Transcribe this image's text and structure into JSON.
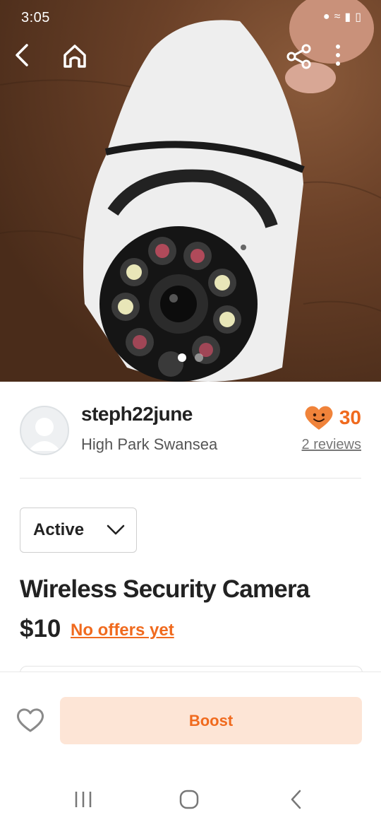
{
  "status_bar": {
    "time": "3:05"
  },
  "listing": {
    "image_alt": "white bulb-style wireless security camera",
    "photo_index_active": 0,
    "photo_count": 2
  },
  "seller": {
    "name": "steph22june",
    "location": "High Park Swansea",
    "rating_count": "30",
    "reviews_label": "2 reviews"
  },
  "status_dropdown": {
    "value": "Active"
  },
  "item": {
    "title": "Wireless Security Camera",
    "price": "$10",
    "offers_label": "No offers yet"
  },
  "actions": {
    "boost_label": "Boost"
  },
  "colors": {
    "accent": "#f06a1e",
    "boost_bg": "#fde5d6",
    "heart": "#f0833a"
  },
  "icons": [
    "back-arrow-icon",
    "home-icon",
    "share-icon",
    "more-vertical-icon",
    "smiley-heart-icon",
    "chevron-down-icon",
    "favorite-heart-icon",
    "recents-icon",
    "home-circle-icon",
    "nav-back-icon"
  ]
}
